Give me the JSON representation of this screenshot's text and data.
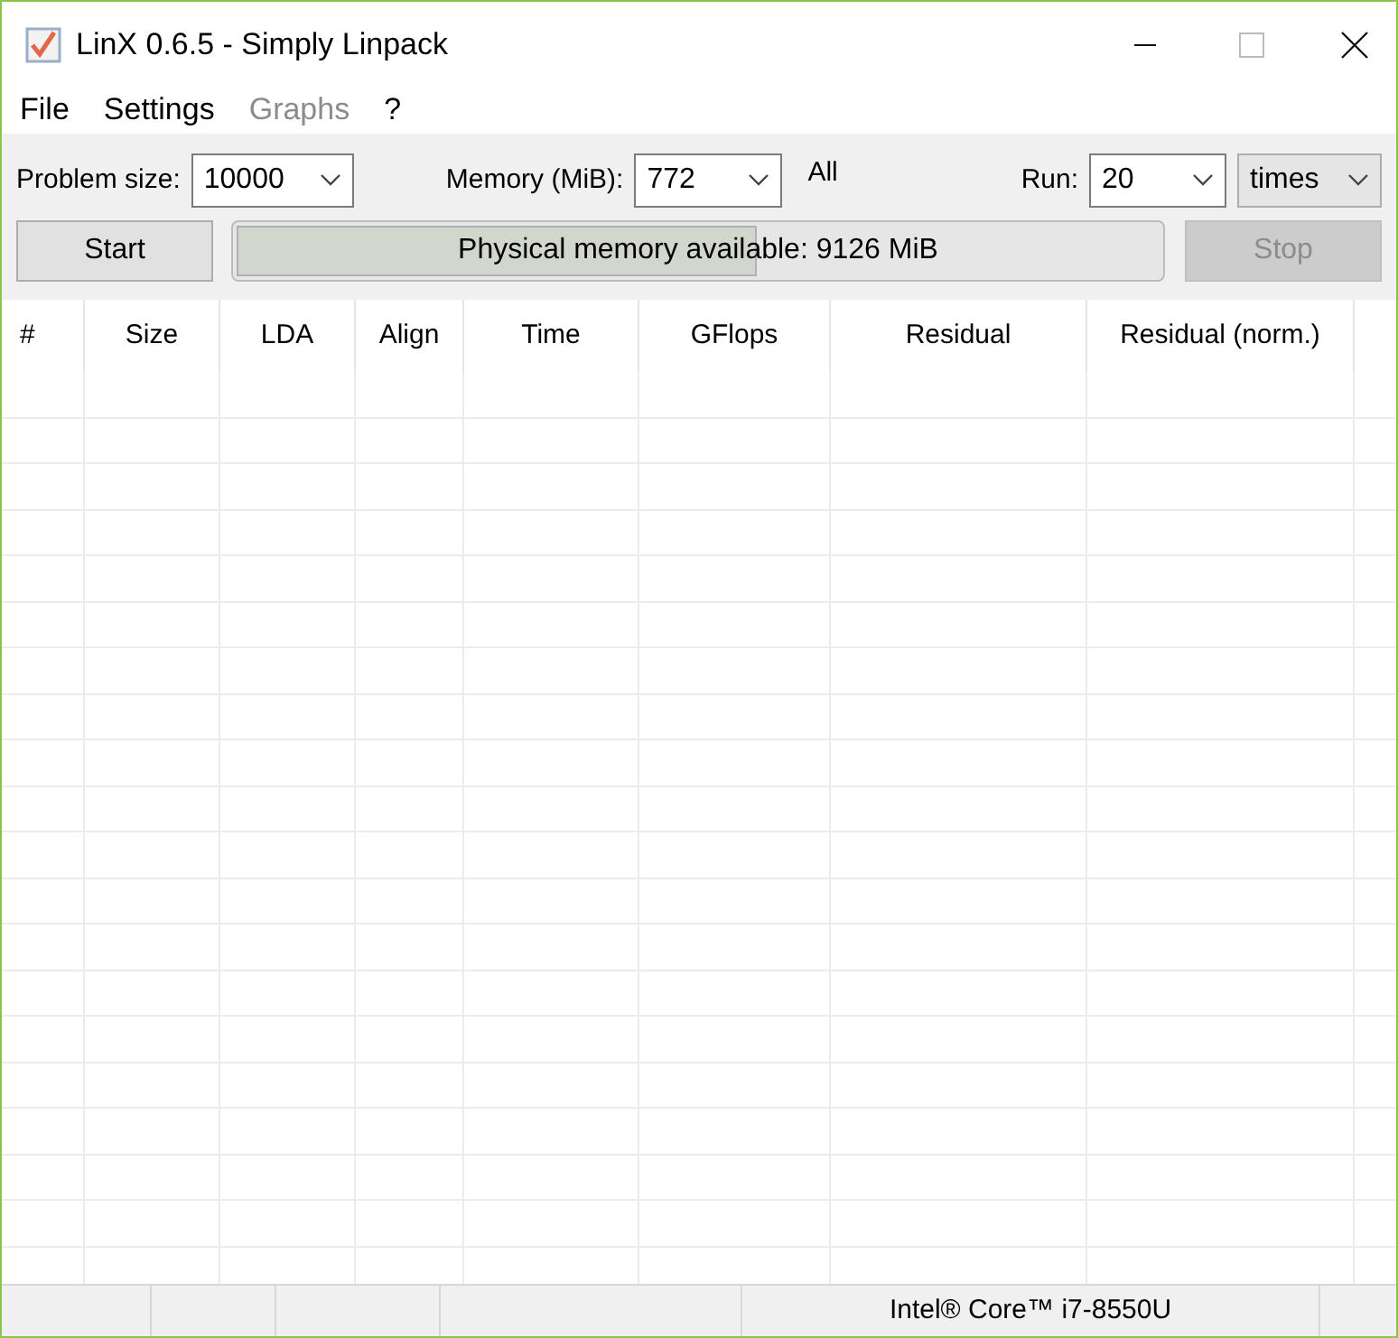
{
  "window": {
    "title": "LinX 0.6.5 - Simply Linpack"
  },
  "menu": [
    {
      "label": "File",
      "disabled": false
    },
    {
      "label": "Settings",
      "disabled": false
    },
    {
      "label": "Graphs",
      "disabled": true
    },
    {
      "label": "?",
      "disabled": false
    }
  ],
  "toolbar": {
    "problem_size": {
      "label": "Problem size:",
      "value": "10000"
    },
    "memory": {
      "label": "Memory (MiB):",
      "value": "772"
    },
    "all_label": "All",
    "run": {
      "label": "Run:",
      "value": "20"
    },
    "run_unit": {
      "value": "times"
    },
    "start": {
      "label": "Start",
      "disabled": false
    },
    "memory_bar": {
      "text": "Physical memory available: 9126 MiB",
      "level": 0.56
    },
    "stop": {
      "label": "Stop",
      "disabled": true
    }
  },
  "table": {
    "columns": [
      "#",
      "Size",
      "LDA",
      "Align",
      "Time",
      "GFlops",
      "Residual",
      "Residual (norm.)"
    ]
  },
  "status_bar": {
    "cpu": "Intel® Core™ i7-8550U"
  }
}
